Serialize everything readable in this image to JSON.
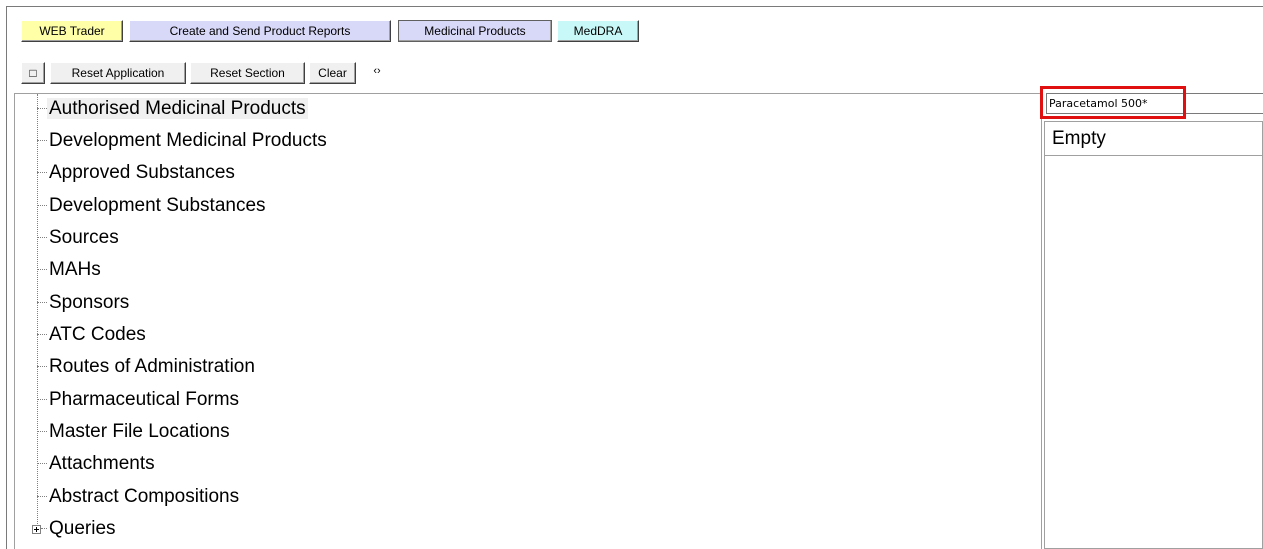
{
  "tabs": [
    {
      "label": "WEB Trader",
      "color": "#ffffa8"
    },
    {
      "label": "Create and Send Product Reports",
      "color": "#d8d8f8"
    },
    {
      "label": "Medicinal Products",
      "color": "#d8d8f8"
    },
    {
      "label": "MedDRA",
      "color": "#c8f8f8"
    }
  ],
  "toolbar": {
    "checkbox_icon": "□",
    "reset_application_label": "Reset Application",
    "reset_section_label": "Reset Section",
    "clear_label": "Clear",
    "refresh_icon": "‹›"
  },
  "tree": {
    "items": [
      {
        "label": "Authorised Medicinal Products"
      },
      {
        "label": "Development Medicinal Products"
      },
      {
        "label": "Approved Substances"
      },
      {
        "label": "Development Substances"
      },
      {
        "label": "Sources"
      },
      {
        "label": "MAHs"
      },
      {
        "label": "Sponsors"
      },
      {
        "label": "ATC Codes"
      },
      {
        "label": "Routes of Administration"
      },
      {
        "label": "Pharmaceutical Forms"
      },
      {
        "label": "Master File Locations"
      },
      {
        "label": "Attachments"
      },
      {
        "label": "Abstract Compositions"
      },
      {
        "label": "Queries"
      }
    ]
  },
  "search": {
    "value": "Paracetamol 500*"
  },
  "results": {
    "header": "Empty"
  },
  "colors": {
    "highlight": "#e01010"
  }
}
